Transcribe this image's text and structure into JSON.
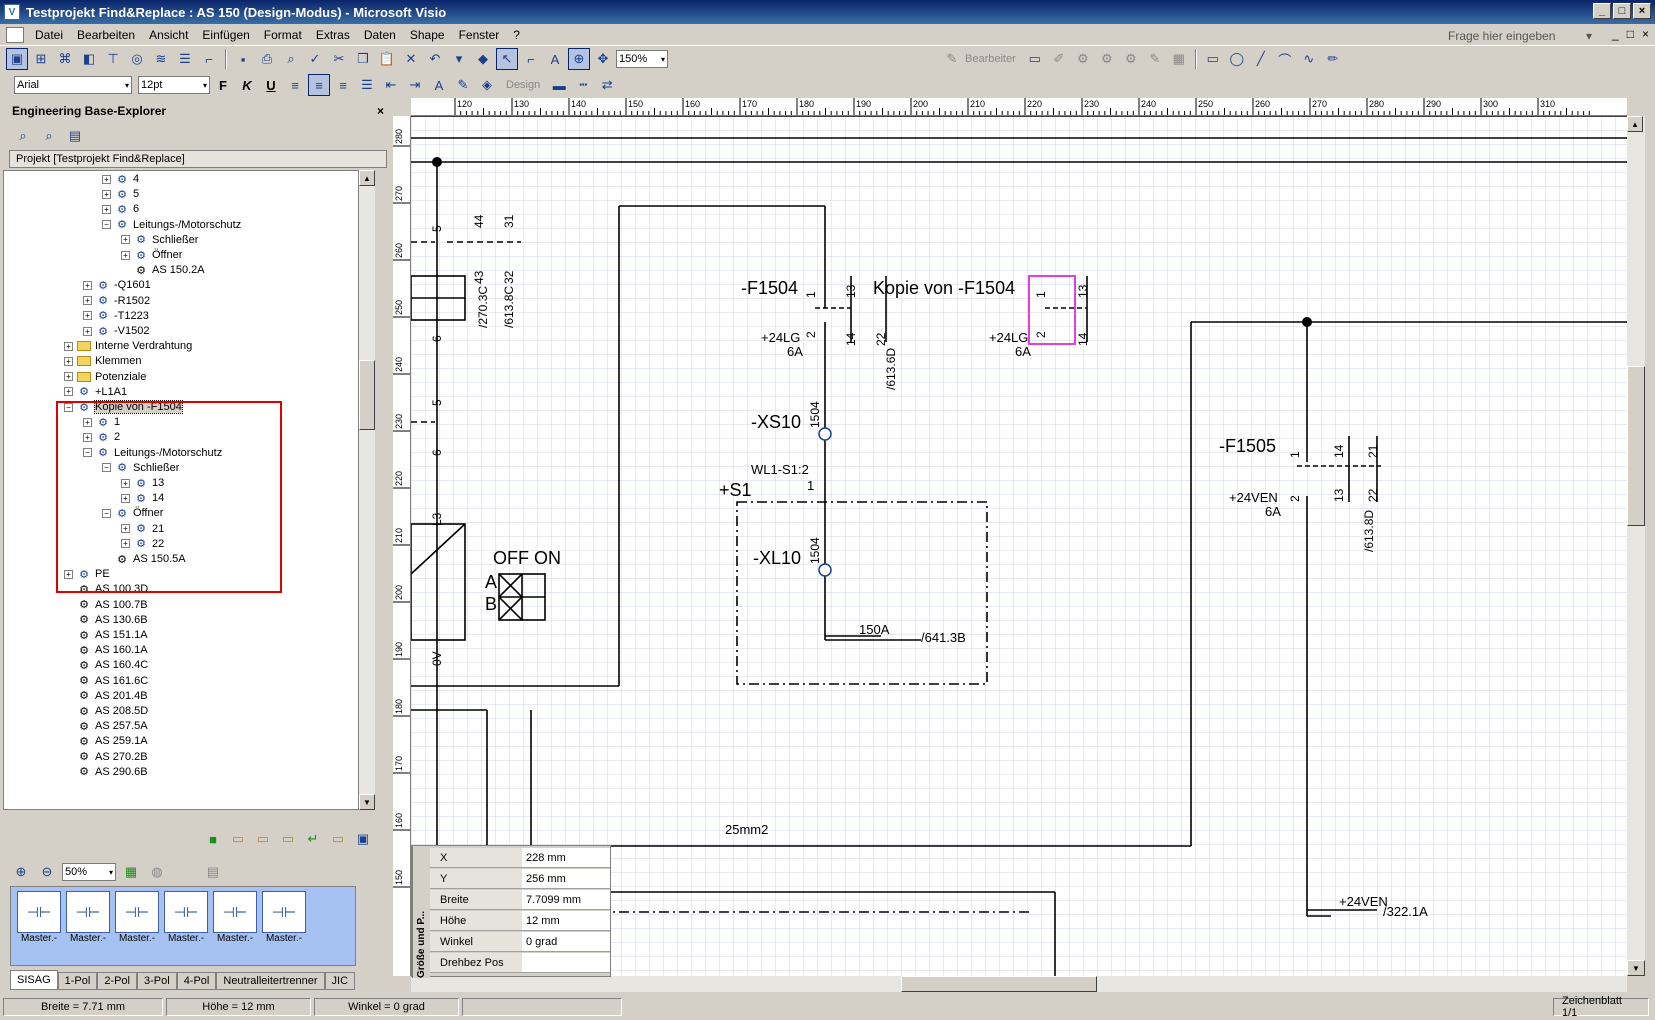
{
  "window": {
    "title": "Testprojekt Find&Replace : AS 150 (Design-Modus) - Microsoft Visio",
    "btn_min": "_",
    "btn_max": "□",
    "btn_close": "×"
  },
  "menu": {
    "items": [
      "Datei",
      "Bearbeiten",
      "Ansicht",
      "Einfügen",
      "Format",
      "Extras",
      "Daten",
      "Shape",
      "Fenster",
      "?"
    ],
    "help_placeholder": "Frage hier eingeben",
    "doc_min": "_",
    "doc_max": "□",
    "doc_close": "×"
  },
  "toolbar": {
    "zoom": "150%",
    "font": "Arial",
    "font_size": "12pt",
    "bold": "F",
    "italic": "K",
    "underline": "U",
    "design_label": "Design",
    "bearbeiter_label": "Bearbeiter"
  },
  "explorer": {
    "title": "Engineering Base-Explorer",
    "close": "×",
    "project": "Projekt [Testprojekt Find&Replace]",
    "tree": [
      {
        "label": "4",
        "level": 5,
        "exp": "+",
        "icon": "dev"
      },
      {
        "label": "5",
        "level": 5,
        "exp": "+",
        "icon": "dev"
      },
      {
        "label": "6",
        "level": 5,
        "exp": "+",
        "icon": "dev"
      },
      {
        "label": "Leitungs-/Motorschutz",
        "level": 5,
        "exp": "−",
        "icon": "dev"
      },
      {
        "label": "Schließer",
        "level": 6,
        "exp": "+",
        "icon": "dev"
      },
      {
        "label": "Öffner",
        "level": 6,
        "exp": "+",
        "icon": "dev"
      },
      {
        "label": "AS 150.2A",
        "level": 6,
        "exp": "",
        "icon": "sheet"
      },
      {
        "label": "-Q1601",
        "level": 4,
        "exp": "+",
        "icon": "dev"
      },
      {
        "label": "-R1502",
        "level": 4,
        "exp": "+",
        "icon": "dev"
      },
      {
        "label": "-T1223",
        "level": 4,
        "exp": "+",
        "icon": "dev"
      },
      {
        "label": "-V1502",
        "level": 4,
        "exp": "+",
        "icon": "dev"
      },
      {
        "label": "Interne Verdrahtung",
        "level": 3,
        "exp": "+",
        "icon": "folder"
      },
      {
        "label": "Klemmen",
        "level": 3,
        "exp": "+",
        "icon": "folder"
      },
      {
        "label": "Potenziale",
        "level": 3,
        "exp": "+",
        "icon": "folder"
      },
      {
        "label": "+L1A1",
        "level": 3,
        "exp": "+",
        "icon": "dev"
      },
      {
        "label": "Kopie von -F1504",
        "level": 3,
        "exp": "−",
        "icon": "dev",
        "selected": true
      },
      {
        "label": "1",
        "level": 4,
        "exp": "+",
        "icon": "dev"
      },
      {
        "label": "2",
        "level": 4,
        "exp": "+",
        "icon": "dev"
      },
      {
        "label": "Leitungs-/Motorschutz",
        "level": 4,
        "exp": "−",
        "icon": "dev"
      },
      {
        "label": "Schließer",
        "level": 5,
        "exp": "−",
        "icon": "dev"
      },
      {
        "label": "13",
        "level": 6,
        "exp": "+",
        "icon": "dev"
      },
      {
        "label": "14",
        "level": 6,
        "exp": "+",
        "icon": "dev"
      },
      {
        "label": "Öffner",
        "level": 5,
        "exp": "−",
        "icon": "dev"
      },
      {
        "label": "21",
        "level": 6,
        "exp": "+",
        "icon": "dev"
      },
      {
        "label": "22",
        "level": 6,
        "exp": "+",
        "icon": "dev"
      },
      {
        "label": "AS 150.5A",
        "level": 5,
        "exp": "",
        "icon": "sheet"
      },
      {
        "label": "PE",
        "level": 3,
        "exp": "+",
        "icon": "dev"
      },
      {
        "label": "AS 100.3D",
        "level": 3,
        "exp": "",
        "icon": "sheet"
      },
      {
        "label": "AS 100.7B",
        "level": 3,
        "exp": "",
        "icon": "sheet"
      },
      {
        "label": "AS 130.6B",
        "level": 3,
        "exp": "",
        "icon": "sheet"
      },
      {
        "label": "AS 151.1A",
        "level": 3,
        "exp": "",
        "icon": "sheet"
      },
      {
        "label": "AS 160.1A",
        "level": 3,
        "exp": "",
        "icon": "sheet"
      },
      {
        "label": "AS 160.4C",
        "level": 3,
        "exp": "",
        "icon": "sheet"
      },
      {
        "label": "AS 161.6C",
        "level": 3,
        "exp": "",
        "icon": "sheet"
      },
      {
        "label": "AS 201.4B",
        "level": 3,
        "exp": "",
        "icon": "sheet"
      },
      {
        "label": "AS 208.5D",
        "level": 3,
        "exp": "",
        "icon": "sheet"
      },
      {
        "label": "AS 257.5A",
        "level": 3,
        "exp": "",
        "icon": "sheet"
      },
      {
        "label": "AS 259.1A",
        "level": 3,
        "exp": "",
        "icon": "sheet"
      },
      {
        "label": "AS 270.2B",
        "level": 3,
        "exp": "",
        "icon": "sheet"
      },
      {
        "label": "AS 290.6B",
        "level": 3,
        "exp": "",
        "icon": "sheet"
      }
    ],
    "stencil_zoom": "50%",
    "masters": [
      "Master.-",
      "Master.-",
      "Master.-",
      "Master.-",
      "Master.-",
      "Master.-"
    ],
    "tabs": [
      "SISAG",
      "1-Pol",
      "2-Pol",
      "3-Pol",
      "4-Pol",
      "Neutralleitertrenner",
      "JIC"
    ]
  },
  "ruler": {
    "h_ticks": [
      "120",
      "130",
      "140",
      "150",
      "160",
      "170",
      "180",
      "190",
      "200",
      "210",
      "220",
      "230",
      "240",
      "250",
      "260",
      "270",
      "280",
      "290",
      "300",
      "310"
    ],
    "v_ticks": [
      "280",
      "270",
      "260",
      "250",
      "240",
      "230",
      "220",
      "210",
      "200",
      "190",
      "180",
      "170",
      "160",
      "150"
    ]
  },
  "drawing": {
    "f1504": "-F1504",
    "kopie": "Kopie von -F1504",
    "f1505": "-F1505",
    "xs10": "-XS10",
    "xl10": "-XL10",
    "s1": "+S1",
    "wl1": "WL1-S1:2",
    "off_on": "OFF ON",
    "a": "A",
    "b": "B",
    "lg1": "+24LG",
    "lg2": "+24LG",
    "ven1": "+24VEN",
    "ven2": "+24VEN",
    "amp1": "6A",
    "amp2": "6A",
    "amp3": "6A",
    "amp150": "150A",
    "ref6413": "/641.3B",
    "ref3221": "/322.1A",
    "ref6136d": "/613.6D",
    "ref6138d": "/613.8D",
    "ref2703c": "/270.3C",
    "ref6138c": "/613.8C",
    "mm25": "25mm2",
    "n1504a": "1504",
    "n1504b": "1504",
    "n1": "1",
    "pins": [
      "1",
      "2",
      "13",
      "14",
      "22",
      "1",
      "2",
      "13",
      "14",
      "1",
      "2",
      "14",
      "21",
      "13",
      "22",
      "5",
      "6",
      "5",
      "6",
      "44",
      "43",
      "31",
      "32",
      "L3",
      "0V"
    ]
  },
  "props": {
    "title": "Größe und P...",
    "rows": [
      {
        "k": "X",
        "v": "228 mm"
      },
      {
        "k": "Y",
        "v": "256 mm"
      },
      {
        "k": "Breite",
        "v": "7.7099 mm"
      },
      {
        "k": "Höhe",
        "v": "12 mm"
      },
      {
        "k": "Winkel",
        "v": "0 grad"
      },
      {
        "k": "Drehbez Pos",
        "v": ""
      }
    ]
  },
  "status": {
    "breite": "Breite = 7.71 mm",
    "hoehe": "Höhe = 12 mm",
    "winkel": "Winkel = 0 grad",
    "page": "Zeichenblatt 1/1"
  },
  "colors": {
    "accent": "#0a246a",
    "selection": "#e040e0",
    "highlight": "#e00000"
  }
}
